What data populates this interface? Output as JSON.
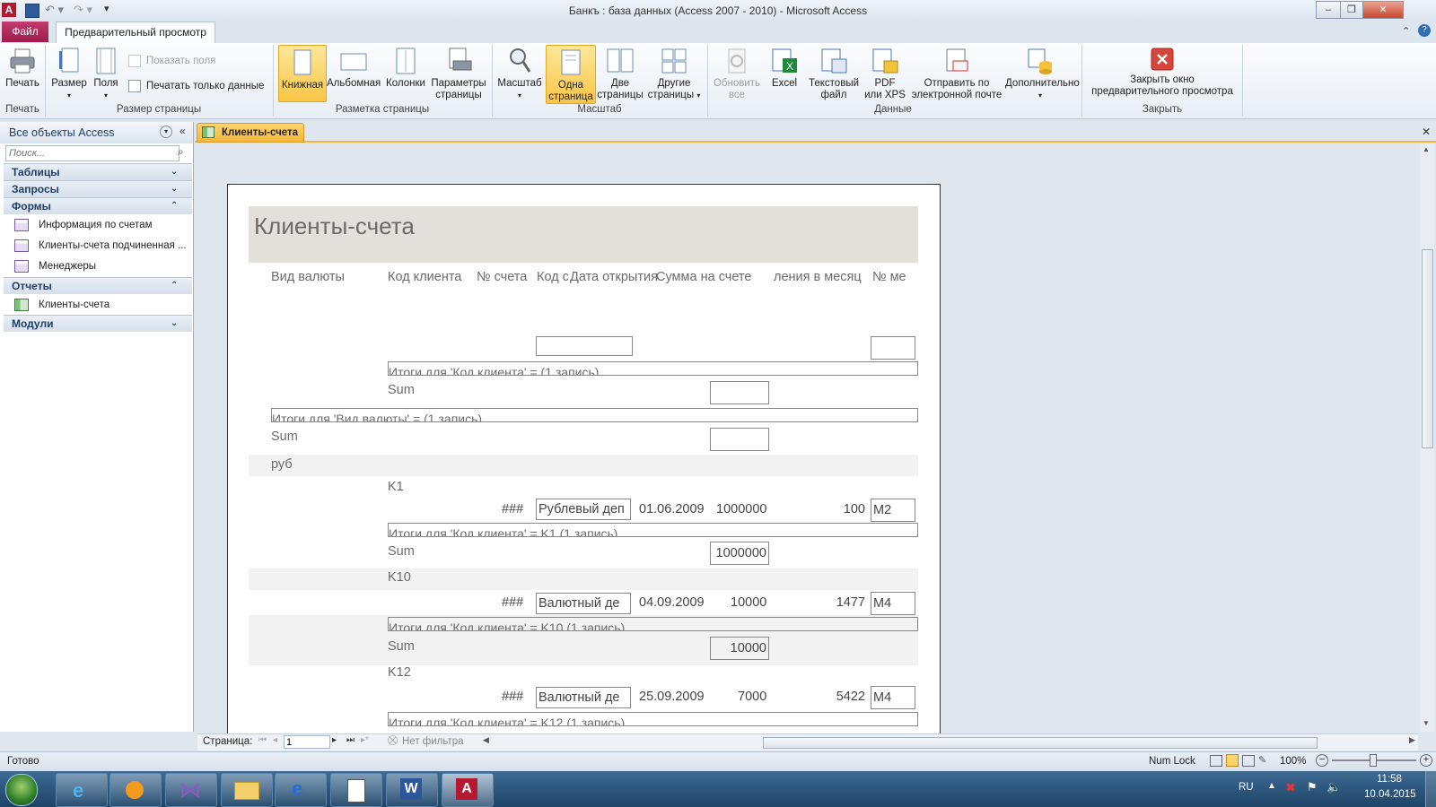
{
  "window": {
    "title": "Банкъ : база данных (Access 2007 - 2010)  -  Microsoft Access",
    "app_icon": "A"
  },
  "tabs": {
    "file": "Файл",
    "preview": "Предварительный просмотр"
  },
  "ribbon": {
    "print": {
      "label": "Печать",
      "group": "Печать"
    },
    "size": "Размер",
    "margins": "Поля",
    "show_fields": "Показать поля",
    "print_data_only": "Печатать только данные",
    "page_size_group": "Размер страницы",
    "portrait": "Книжная",
    "landscape": "Альбомная",
    "columns": "Колонки",
    "page_setup": [
      "Параметры",
      "страницы"
    ],
    "page_layout_group": "Разметка страницы",
    "zoom": "Масштаб",
    "one_page": [
      "Одна",
      "страница"
    ],
    "two_pages": [
      "Две",
      "страницы"
    ],
    "more_pages": [
      "Другие",
      "страницы"
    ],
    "zoom_group": "Масштаб",
    "refresh_all": [
      "Обновить",
      "все"
    ],
    "excel": "Excel",
    "text_file": [
      "Текстовый",
      "файл"
    ],
    "pdf": [
      "PDF",
      "или XPS"
    ],
    "email": [
      "Отправить по",
      "электронной почте"
    ],
    "more": "Дополнительно",
    "data_group": "Данные",
    "close_preview": [
      "Закрыть окно",
      "предварительного просмотра"
    ],
    "close_group": "Закрыть"
  },
  "nav": {
    "header": "Все объекты Access",
    "search_placeholder": "Поиск...",
    "groups": {
      "tables": "Таблицы",
      "queries": "Запросы",
      "forms": "Формы",
      "reports": "Отчеты",
      "modules": "Модули"
    },
    "forms": [
      "Информация по счетам",
      "Клиенты-счета подчиненная ...",
      "Менеджеры"
    ],
    "reports": [
      "Клиенты-счета"
    ]
  },
  "document_tab": "Клиенты-счета",
  "report": {
    "title": "Клиенты-счета",
    "headers": {
      "currency": "Вид валюты",
      "client_code": "Код клиента",
      "account_no": "№ счета",
      "code_part": "Код с",
      "open_date": "Дата открытия",
      "amount_on_account": "Сумма на счете",
      "monthly": "ления в месяц",
      "no": "№ ме"
    },
    "summary_client_empty": "Итоги для 'Код клиента' =  (1 запись)",
    "sum_label": "Sum",
    "summary_currency_empty": "Итоги для 'Вид валюты' =  (1 запись)",
    "currency_value": "руб",
    "clients": [
      {
        "code": "K1",
        "account": "###",
        "type": "Рублевый деп",
        "date": "01.06.2009",
        "amount": "1000000",
        "monthly": "100",
        "manager": "M2",
        "summary": "Итоги для 'Код клиента' = K1 (1 запись)",
        "sum": "1000000"
      },
      {
        "code": "K10",
        "account": "###",
        "type": "Валютный де",
        "date": "04.09.2009",
        "amount": "10000",
        "monthly": "1477",
        "manager": "M4",
        "summary": "Итоги для 'Код клиента' = K10 (1 запись)",
        "sum": "10000"
      },
      {
        "code": "K12",
        "account": "###",
        "type": "Валютный де",
        "date": "25.09.2009",
        "amount": "7000",
        "monthly": "5422",
        "manager": "M4",
        "summary": "Итоги для 'Код клиента' = K12 (1 запись)"
      }
    ]
  },
  "navigation": {
    "page_label": "Страница:",
    "page_value": "1",
    "filter": "Нет фильтра"
  },
  "status": {
    "ready": "Готово",
    "num_lock": "Num Lock",
    "zoom": "100%"
  },
  "taskbar": {
    "lang": "RU",
    "time": "11:58",
    "date": "10.04.2015"
  }
}
